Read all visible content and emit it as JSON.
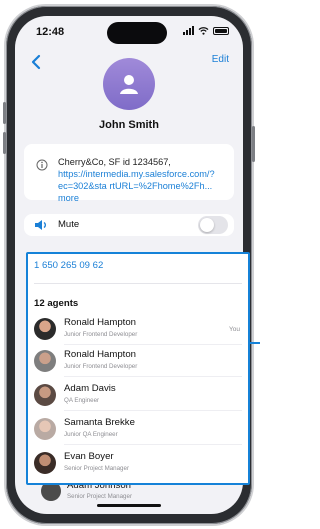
{
  "status_bar": {
    "time": "12:48"
  },
  "nav": {
    "edit_label": "Edit"
  },
  "contact": {
    "name": "John Smith",
    "info_text": "Cherry&Co, SF id 1234567, ",
    "info_link": "https://intermedia.my.salesforce.com/?ec=302&sta rtURL=%2Fhome%2Fh...",
    "more_label": "more",
    "mute_label": "Mute",
    "mute_on": false,
    "phone_number": "1 650 265 09 62"
  },
  "agents": {
    "header": "12 agents",
    "items": [
      {
        "name": "Ronald Hampton",
        "role": "Junior Frontend Developer",
        "badge": "You",
        "avatar_color": "#2b2b2b"
      },
      {
        "name": "Ronald Hampton",
        "role": "Junior Frontend Developer",
        "badge": "",
        "avatar_color": "#7e7e7e"
      },
      {
        "name": "Adam Davis",
        "role": "QA Engineer",
        "badge": "",
        "avatar_color": "#5b4a43"
      },
      {
        "name": "Samanta Brekke",
        "role": "Junior QA Engineer",
        "badge": "",
        "avatar_color": "#b9aaa3"
      },
      {
        "name": "Evan Boyer",
        "role": "Senior Project Manager",
        "badge": "",
        "avatar_color": "#3a2c27"
      }
    ],
    "below_selection": {
      "name": "Adam Johnson",
      "role": "Senior Project Manager",
      "avatar_color": "#4b4b4b"
    }
  },
  "colors": {
    "accent": "#1a7fd6",
    "selection": "#1582d8",
    "avatar_gradient_top": "#a08ad9",
    "avatar_gradient_bottom": "#7f6cc8"
  },
  "icons": [
    "back-chevron-icon",
    "person-icon",
    "info-icon",
    "speaker-icon"
  ]
}
